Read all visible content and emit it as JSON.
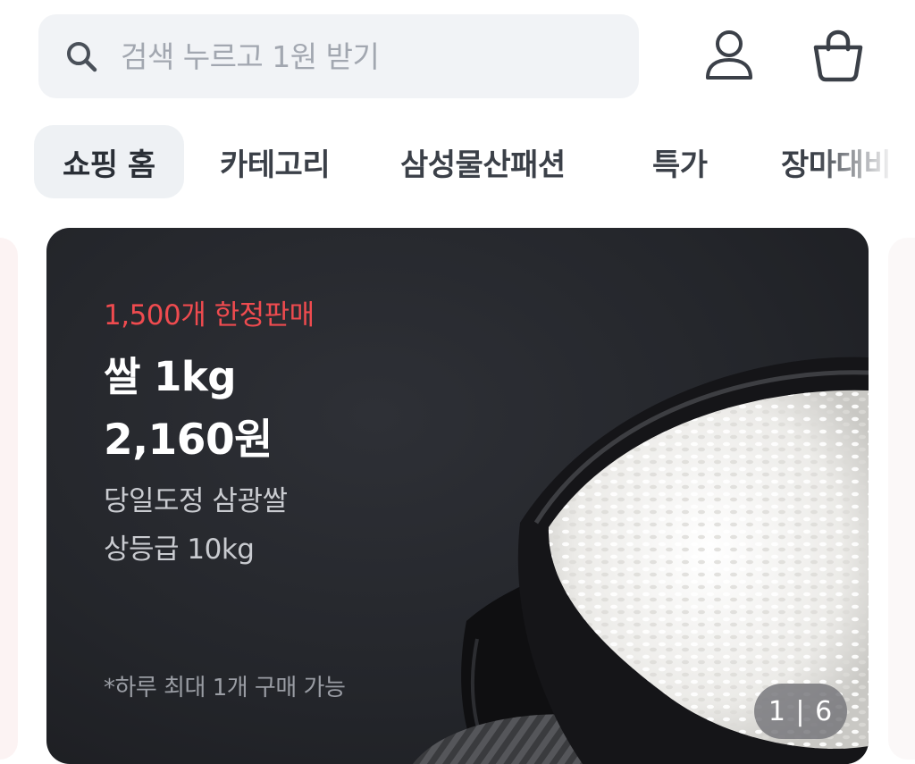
{
  "search": {
    "placeholder": "검색 누르고 1원 받기",
    "value": ""
  },
  "header": {
    "icons": [
      "search-icon",
      "user-icon",
      "shopping-bag-icon"
    ]
  },
  "tabs": [
    {
      "label": "쇼핑 홈",
      "active": true
    },
    {
      "label": "카테고리",
      "active": false
    },
    {
      "label": "삼성물산패션",
      "active": false
    },
    {
      "label": "특가",
      "active": false
    },
    {
      "label": "장마대비",
      "active": false
    }
  ],
  "banner": {
    "limited": "1,500개 한정판매",
    "title": "쌀 1kg",
    "price": "2,160원",
    "desc_line1": "당일도정 삼광쌀",
    "desc_line2": "상등급 10kg",
    "note": "*하루 최대 1개 구매 가능",
    "pager": "1 | 6"
  },
  "colors": {
    "accent_red": "#ef4b4f",
    "banner_bg": "#25272c",
    "search_bg": "#f1f3f6",
    "tab_active_bg": "#eef1f4"
  }
}
